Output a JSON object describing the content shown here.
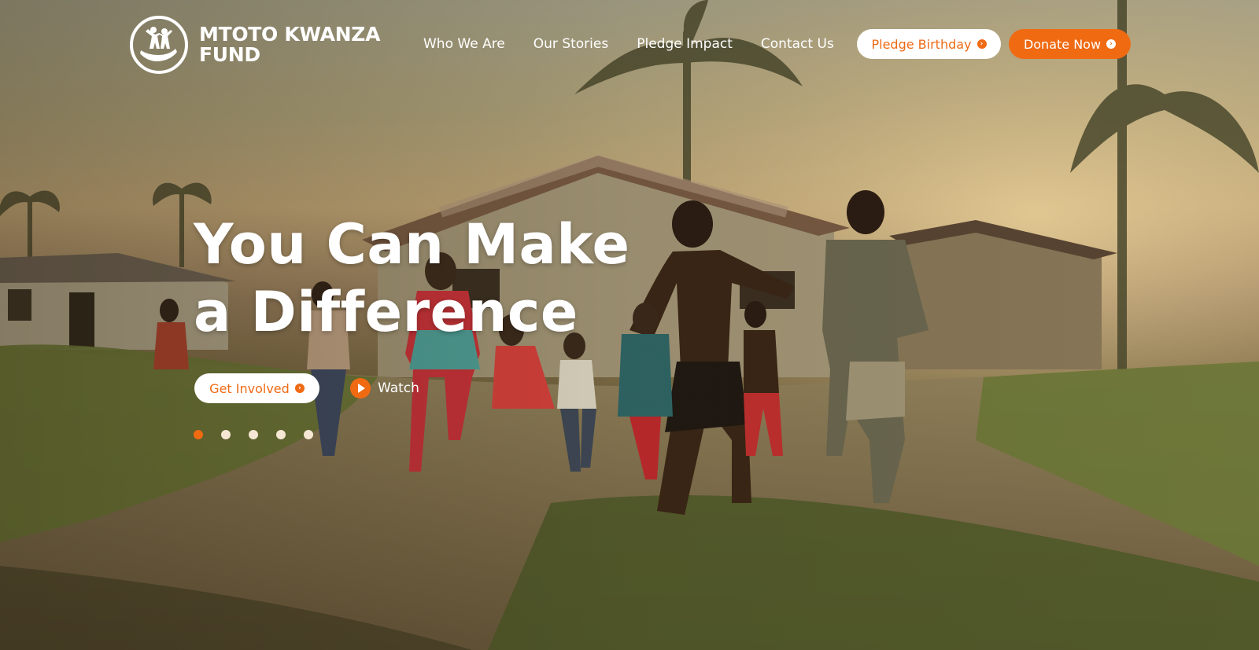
{
  "brand": {
    "name_line1": "MTOTO KWANZA",
    "name_line2": "FUND",
    "logo_icon": "children-in-hand-icon"
  },
  "nav": {
    "items": [
      {
        "label": "Who We Are"
      },
      {
        "label": "Our Stories"
      },
      {
        "label": "Pledge Impact"
      },
      {
        "label": "Contact Us"
      }
    ]
  },
  "header_actions": {
    "pledge_label": "Pledge Birthday",
    "donate_label": "Donate Now"
  },
  "hero": {
    "headline_line1": "You Can Make",
    "headline_line2": "a Difference",
    "cta_label": "Get Involved",
    "watch_label": "Watch",
    "slides_total": 5,
    "active_slide": 1
  },
  "colors": {
    "accent": "#f06a12",
    "text_on_hero": "#ffffff",
    "dot_inactive": "#f6e7d4"
  }
}
